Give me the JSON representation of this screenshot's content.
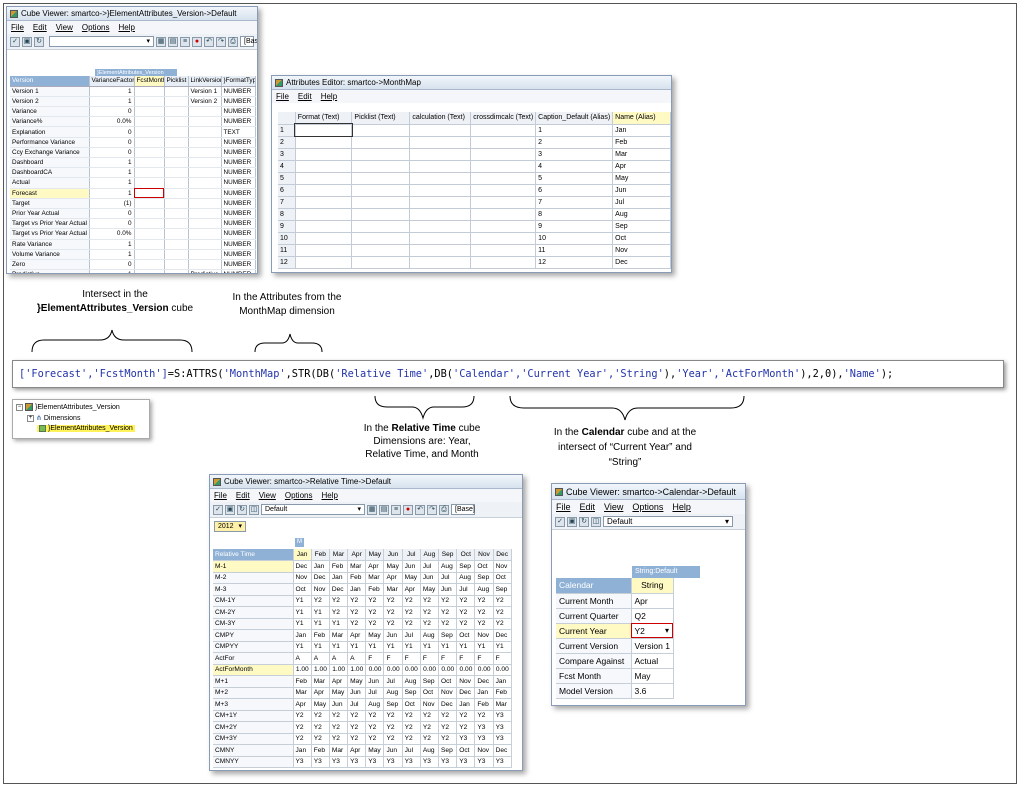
{
  "w1": {
    "title": "Cube Viewer: smartco->}ElementAttributes_Version->Default",
    "menu": [
      "File",
      "Edit",
      "View",
      "Options",
      "Help"
    ],
    "toolbar_base": "[Bas",
    "dim_header": "}ElementAttributes_Version",
    "row_dim": "Version",
    "cols": [
      "VarianceFactor",
      "FcstMonth",
      "Picklist",
      "LinkVersion",
      "}FormatType"
    ],
    "rows": [
      [
        "Version 1",
        "1",
        "",
        "",
        "Version 1",
        "NUMBER"
      ],
      [
        "Version 2",
        "1",
        "",
        "",
        "Version 2",
        "NUMBER"
      ],
      [
        "Variance",
        "0",
        "",
        "",
        "",
        "NUMBER"
      ],
      [
        "Variance%",
        "0.0%",
        "",
        "",
        "",
        "NUMBER"
      ],
      [
        "Explanation",
        "0",
        "",
        "",
        "",
        "TEXT"
      ],
      [
        "Performance Variance",
        "0",
        "",
        "",
        "",
        "NUMBER"
      ],
      [
        "Ccy Exchange Variance",
        "0",
        "",
        "",
        "",
        "NUMBER"
      ],
      [
        "Dashboard",
        "1",
        "",
        "",
        "",
        "NUMBER"
      ],
      [
        "DashboardCA",
        "1",
        "",
        "",
        "",
        "NUMBER"
      ],
      [
        "Actual",
        "1",
        "",
        "",
        "",
        "NUMBER"
      ],
      [
        "Forecast",
        "1",
        "",
        "",
        "",
        "NUMBER"
      ],
      [
        "Target",
        "(1)",
        "",
        "",
        "",
        "NUMBER"
      ],
      [
        "Prior Year Actual",
        "0",
        "",
        "",
        "",
        "NUMBER"
      ],
      [
        "Target vs Prior Year Actual",
        "0",
        "",
        "",
        "",
        "NUMBER"
      ],
      [
        "Target vs Prior Year Actual %",
        "0.0%",
        "",
        "",
        "",
        "NUMBER"
      ],
      [
        "Rate Variance",
        "1",
        "",
        "",
        "",
        "NUMBER"
      ],
      [
        "Volume Variance",
        "1",
        "",
        "",
        "",
        "NUMBER"
      ],
      [
        "Zero",
        "0",
        "",
        "",
        "",
        "NUMBER"
      ],
      [
        "Predictive",
        "1",
        "",
        "",
        "Predictive",
        "NUMBER"
      ]
    ]
  },
  "w2": {
    "title": "Attributes Editor: smartco->MonthMap",
    "menu": [
      "File",
      "Edit",
      "Help"
    ],
    "cols": [
      "Format (Text)",
      "Picklist (Text)",
      "calculation (Text)",
      "crossdimcalc (Text)",
      "Caption_Default (Alias)",
      "Name (Alias)"
    ],
    "rows": [
      [
        "1",
        "1",
        "Jan"
      ],
      [
        "2",
        "2",
        "Feb"
      ],
      [
        "3",
        "3",
        "Mar"
      ],
      [
        "4",
        "4",
        "Apr"
      ],
      [
        "5",
        "5",
        "May"
      ],
      [
        "6",
        "6",
        "Jun"
      ],
      [
        "7",
        "7",
        "Jul"
      ],
      [
        "8",
        "8",
        "Aug"
      ],
      [
        "9",
        "9",
        "Sep"
      ],
      [
        "10",
        "10",
        "Oct"
      ],
      [
        "11",
        "11",
        "Nov"
      ],
      [
        "12",
        "12",
        "Dec"
      ]
    ]
  },
  "captions": {
    "c1_line1": "Intersect in the",
    "c1_bold": "}ElementAttributes_Version",
    "c1_rest": " cube",
    "c2_line1": "In the Attributes from the",
    "c2_line2": "MonthMap dimension",
    "c3_pre": "In the ",
    "c3_bold": "Relative Time",
    "c3_post": " cube",
    "c3_line2": "Dimensions are:  Year,",
    "c3_line3": "Relative Time, and Month",
    "c4_pre": "In the ",
    "c4_bold": "Calendar",
    "c4_post": " cube and at the",
    "c4_line2": "intersect of “Current Year” and",
    "c4_line3": "“String”"
  },
  "formula": {
    "p1": "['Forecast','FcstMonth']",
    "p2": "=S:ATTRS(",
    "p3": "'MonthMap'",
    "p4": ",STR(DB(",
    "p5": "'Relative Time'",
    "p6": ",DB(",
    "p7": "'Calendar','Current Year','String'",
    "p8": "),",
    "p9": "'Year','ActForMonth'",
    "p10": "),2,0),",
    "p11": "'Name'",
    "p12": ");"
  },
  "tree": {
    "root": "}ElementAttributes_Version",
    "child1": "Dimensions",
    "child2": "}ElementAttributes_Version"
  },
  "w3": {
    "title": "Cube Viewer: smartco->Relative Time->Default",
    "menu": [
      "File",
      "Edit",
      "View",
      "Options",
      "Help"
    ],
    "view": "Default",
    "base": "[Base]",
    "year": "2012",
    "col_dim_tag": "M",
    "row_dim": "Relative Time",
    "months": [
      "Jan",
      "Feb",
      "Mar",
      "Apr",
      "May",
      "Jun",
      "Jul",
      "Aug",
      "Sep",
      "Oct",
      "Nov",
      "Dec"
    ],
    "rows": [
      [
        "M-1",
        "Dec",
        "Jan",
        "Feb",
        "Mar",
        "Apr",
        "May",
        "Jun",
        "Jul",
        "Aug",
        "Sep",
        "Oct",
        "Nov"
      ],
      [
        "M-2",
        "Nov",
        "Dec",
        "Jan",
        "Feb",
        "Mar",
        "Apr",
        "May",
        "Jun",
        "Jul",
        "Aug",
        "Sep",
        "Oct"
      ],
      [
        "M-3",
        "Oct",
        "Nov",
        "Dec",
        "Jan",
        "Feb",
        "Mar",
        "Apr",
        "May",
        "Jun",
        "Jul",
        "Aug",
        "Sep"
      ],
      [
        "CM-1Y",
        "Y1",
        "Y2",
        "Y2",
        "Y2",
        "Y2",
        "Y2",
        "Y2",
        "Y2",
        "Y2",
        "Y2",
        "Y2",
        "Y2"
      ],
      [
        "CM-2Y",
        "Y1",
        "Y1",
        "Y2",
        "Y2",
        "Y2",
        "Y2",
        "Y2",
        "Y2",
        "Y2",
        "Y2",
        "Y2",
        "Y2"
      ],
      [
        "CM-3Y",
        "Y1",
        "Y1",
        "Y1",
        "Y2",
        "Y2",
        "Y2",
        "Y2",
        "Y2",
        "Y2",
        "Y2",
        "Y2",
        "Y2"
      ],
      [
        "CMPY",
        "Jan",
        "Feb",
        "Mar",
        "Apr",
        "May",
        "Jun",
        "Jul",
        "Aug",
        "Sep",
        "Oct",
        "Nov",
        "Dec"
      ],
      [
        "CMPYY",
        "Y1",
        "Y1",
        "Y1",
        "Y1",
        "Y1",
        "Y1",
        "Y1",
        "Y1",
        "Y1",
        "Y1",
        "Y1",
        "Y1"
      ],
      [
        "ActFor",
        "A",
        "A",
        "A",
        "A",
        "F",
        "F",
        "F",
        "F",
        "F",
        "F",
        "F",
        "F"
      ],
      [
        "ActForMonth",
        "1.00",
        "1.00",
        "1.00",
        "1.00",
        "0.00",
        "0.00",
        "0.00",
        "0.00",
        "0.00",
        "0.00",
        "0.00",
        "0.00"
      ],
      [
        "M+1",
        "Feb",
        "Mar",
        "Apr",
        "May",
        "Jun",
        "Jul",
        "Aug",
        "Sep",
        "Oct",
        "Nov",
        "Dec",
        "Jan"
      ],
      [
        "M+2",
        "Mar",
        "Apr",
        "May",
        "Jun",
        "Jul",
        "Aug",
        "Sep",
        "Oct",
        "Nov",
        "Dec",
        "Jan",
        "Feb"
      ],
      [
        "M+3",
        "Apr",
        "May",
        "Jun",
        "Jul",
        "Aug",
        "Sep",
        "Oct",
        "Nov",
        "Dec",
        "Jan",
        "Feb",
        "Mar"
      ],
      [
        "CM+1Y",
        "Y2",
        "Y2",
        "Y2",
        "Y2",
        "Y2",
        "Y2",
        "Y2",
        "Y2",
        "Y2",
        "Y2",
        "Y2",
        "Y3"
      ],
      [
        "CM+2Y",
        "Y2",
        "Y2",
        "Y2",
        "Y2",
        "Y2",
        "Y2",
        "Y2",
        "Y2",
        "Y2",
        "Y2",
        "Y3",
        "Y3"
      ],
      [
        "CM+3Y",
        "Y2",
        "Y2",
        "Y2",
        "Y2",
        "Y2",
        "Y2",
        "Y2",
        "Y2",
        "Y2",
        "Y3",
        "Y3",
        "Y3"
      ],
      [
        "CMNY",
        "Jan",
        "Feb",
        "Mar",
        "Apr",
        "May",
        "Jun",
        "Jul",
        "Aug",
        "Sep",
        "Oct",
        "Nov",
        "Dec"
      ],
      [
        "CMNYY",
        "Y3",
        "Y3",
        "Y3",
        "Y3",
        "Y3",
        "Y3",
        "Y3",
        "Y3",
        "Y3",
        "Y3",
        "Y3",
        "Y3"
      ]
    ]
  },
  "w4": {
    "title": "Cube Viewer: smartco->Calendar->Default",
    "menu": [
      "File",
      "Edit",
      "View",
      "Options",
      "Help"
    ],
    "view": "Default",
    "col_header": "String:Default",
    "col": "String",
    "row_dim": "Calendar",
    "rows": [
      [
        "Current Month",
        "Apr"
      ],
      [
        "Current Quarter",
        "Q2"
      ],
      [
        "Current Year",
        "Y2"
      ],
      [
        "Current Version",
        "Version 1"
      ],
      [
        "Compare Against",
        "Actual"
      ],
      [
        "Fcst Month",
        "May"
      ],
      [
        "Model Version",
        "3.6"
      ]
    ]
  },
  "colors": {
    "accent": "#8fb1d6",
    "highlight": "#fff9c4",
    "redbox": "#cc0000",
    "formula_string": "#2233aa"
  }
}
